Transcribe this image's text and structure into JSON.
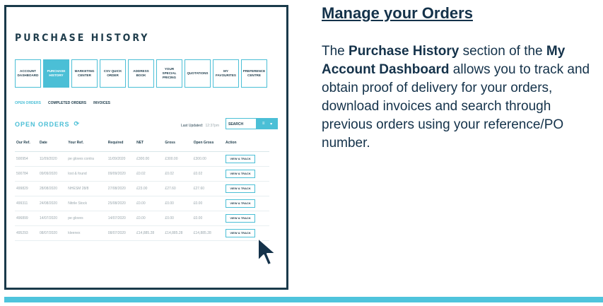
{
  "screenshot": {
    "title": "PURCHASE HISTORY",
    "tiles": [
      {
        "label": "ACCOUNT DASHBOARD"
      },
      {
        "label": "PURCHASE HISTORY"
      },
      {
        "label": "MARKETING CENTER"
      },
      {
        "label": "CSV QUICK ORDER"
      },
      {
        "label": "ADDRESS BOOK"
      },
      {
        "label": "YOUR SPECIAL PRICING"
      },
      {
        "label": "QUOTATIONS"
      },
      {
        "label": "MY FAVOURITES"
      },
      {
        "label": "PREFERENCE CENTRE"
      }
    ],
    "active_tile": "PURCHASE HISTORY",
    "subtabs": [
      "OPEN ORDERS",
      "COMPLETED ORDERS",
      "INVOICES"
    ],
    "orders_heading": "OPEN ORDERS",
    "last_updated_label": "Last Updated:",
    "last_updated_time": "12:37pm",
    "search_placeholder": "SEARCH",
    "columns": [
      "Our Ref.",
      "Date",
      "Your Ref.",
      "Required",
      "NET",
      "Gross",
      "Open Gross",
      "Action"
    ],
    "rows": [
      [
        "500954",
        "11/09/2020",
        "pe gloves contra",
        "11/09/2020",
        "£300.00",
        "£300.00",
        "£300.00"
      ],
      [
        "500784",
        "09/09/2020",
        "lost & found",
        "09/09/2020",
        "£0.02",
        "£0.02",
        "£0.02"
      ],
      [
        "499829",
        "28/08/2020",
        "NHESM 28/8",
        "27/08/2020",
        "£23.00",
        "£27.60",
        "£27.60"
      ],
      [
        "499311",
        "24/08/2020",
        "Nitrile Stock",
        "25/08/2020",
        "£0.00",
        "£0.00",
        "£0.00"
      ],
      [
        "496899",
        "14/07/2020",
        "pe gloves",
        "14/07/2020",
        "£0.00",
        "£0.00",
        "£0.00"
      ],
      [
        "495293",
        "08/07/2020",
        "kleenex",
        "08/07/2020",
        "£14,885.28",
        "£14,885.28",
        "£14,885.28"
      ]
    ],
    "action_label": "VIEW & TRACK"
  },
  "content": {
    "heading": "Manage your Orders",
    "para_1": "The ",
    "para_bold_1": "Purchase History",
    "para_2": " section of the ",
    "para_bold_2": "My Account Dashboard",
    "para_3": " allows you to track and obtain proof of delivery for your orders, download invoices and search through previous orders using your reference/PO number."
  },
  "colors": {
    "accent": "#4bbfd6",
    "dark": "#14324a",
    "bar": "#4ec4dc"
  }
}
